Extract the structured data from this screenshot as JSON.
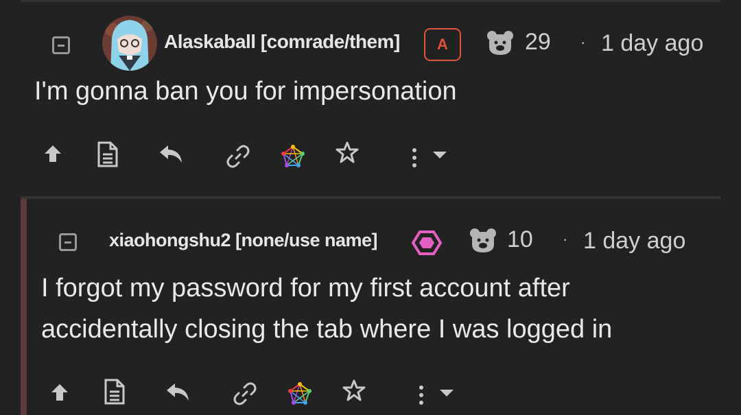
{
  "comments": [
    {
      "username": "Alaskaball [comrade/them]",
      "role_badge": "A",
      "score": "29",
      "separator": "·",
      "time": "1 day ago",
      "body": "I'm gonna ban you for impersonation"
    },
    {
      "username": "xiaohongshu2 [none/use name]",
      "score": "10",
      "separator": "·",
      "time": "1 day ago",
      "body_lines": [
        "I forgot my password for my first account after",
        "accidentally closing the tab where I was logged in"
      ]
    }
  ],
  "icons": {
    "collapse": "collapse-icon",
    "score": "bear-icon",
    "upvote": "arrow-up-icon",
    "view_source": "document-icon",
    "reply": "reply-icon",
    "link": "link-icon",
    "federation": "fediverse-icon",
    "save": "star-icon",
    "more": "more-vertical-icon",
    "dropdown": "caret-down-icon",
    "pronoun_badge": "hexagon-icon"
  },
  "colors": {
    "background": "#222222",
    "admin_badge": "#e0533b",
    "pronoun_badge": "#e35fc3",
    "thread_line": "#5a3a3a"
  }
}
